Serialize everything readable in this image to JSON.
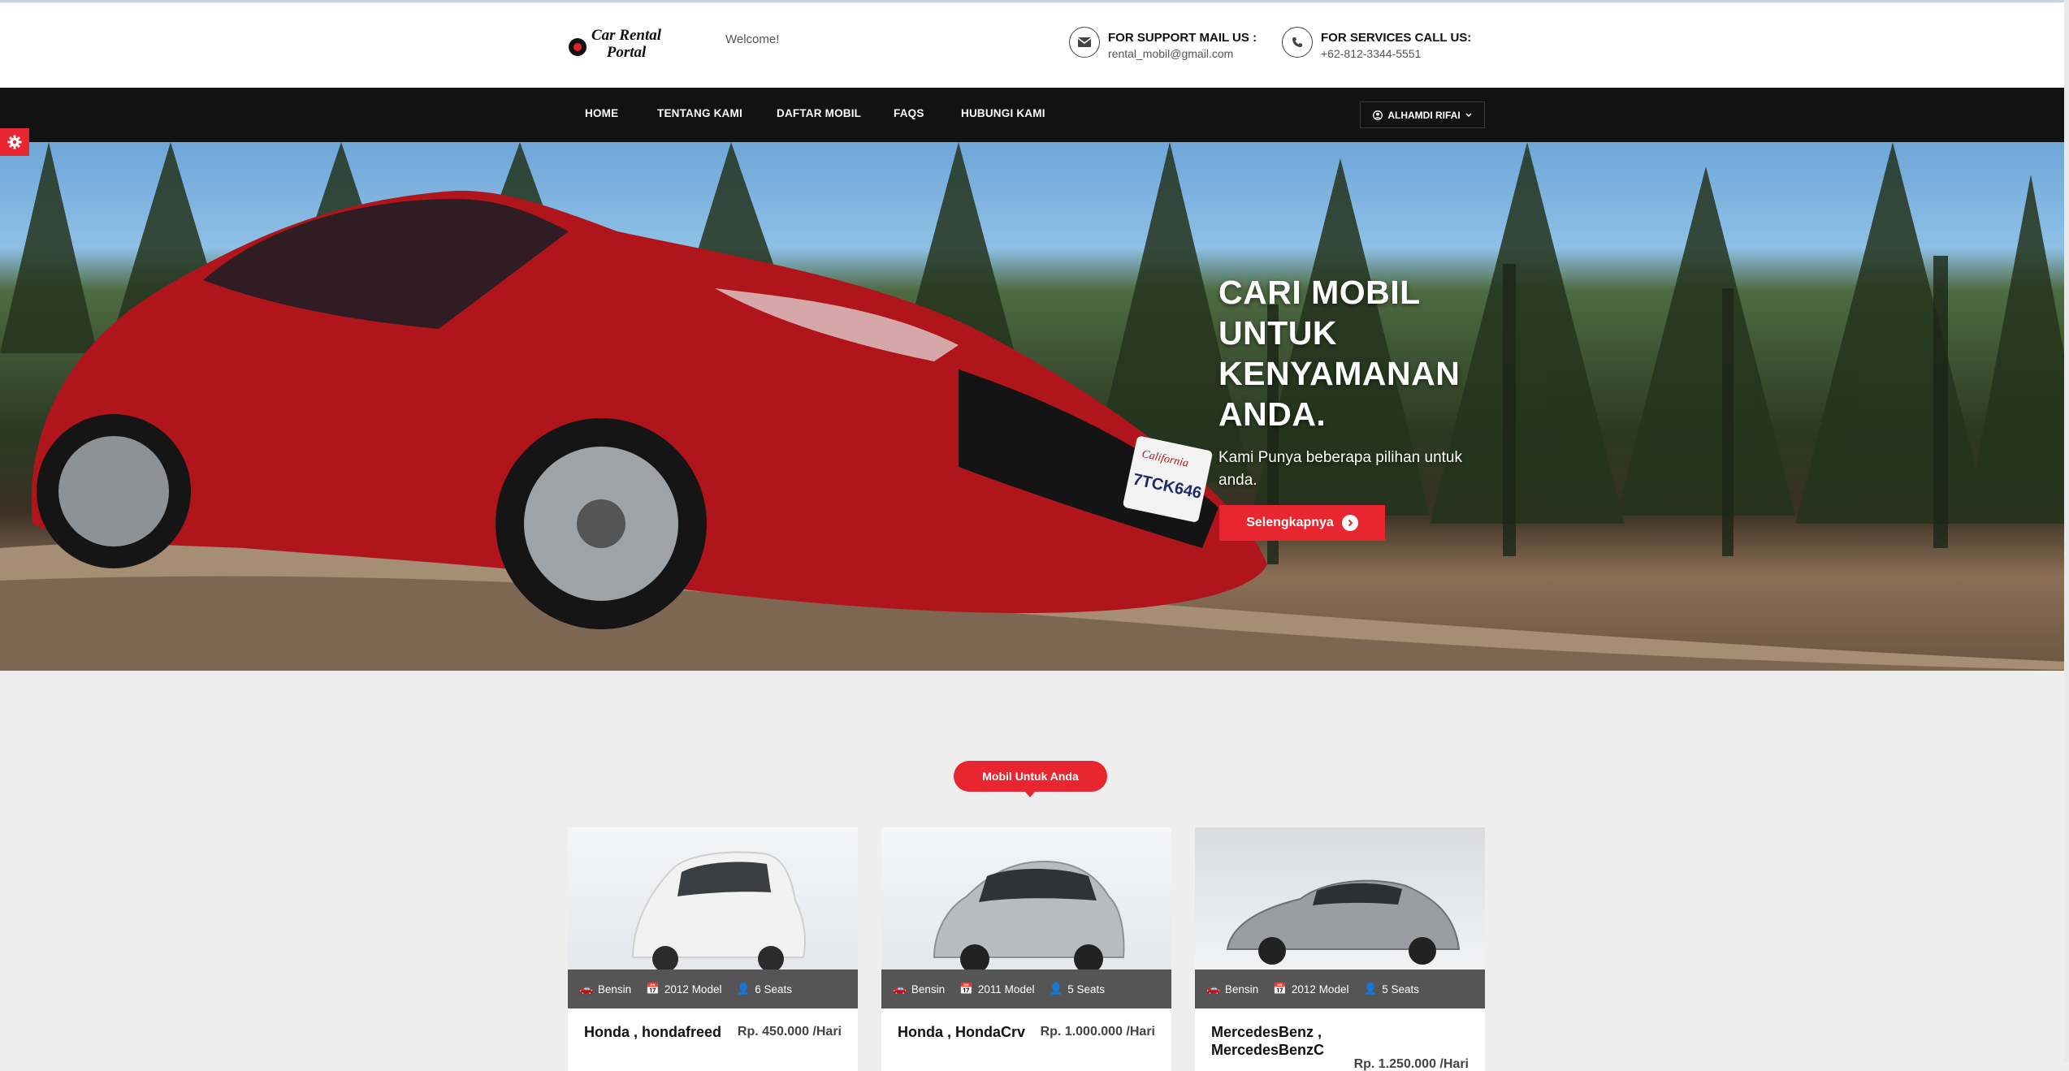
{
  "header": {
    "logo_line1": "Car Rental",
    "logo_line2": "Portal",
    "welcome": "Welcome!",
    "support": {
      "title": "FOR SUPPORT MAIL US :",
      "value": "rental_mobil@gmail.com"
    },
    "services": {
      "title": "FOR SERVICES CALL US:",
      "value": "+62-812-3344-5551"
    }
  },
  "nav": {
    "items": [
      "HOME",
      "TENTANG KAMI",
      "DAFTAR MOBIL",
      "FAQS",
      "HUBUNGI KAMI"
    ],
    "user": "ALHAMDI RIFAI"
  },
  "hero": {
    "title": "CARI MOBIL UNTUK KENYAMANAN ANDA.",
    "subtitle": "Kami Punya beberapa pilihan untuk anda.",
    "button": "Selengkapnya",
    "plate_top": "California",
    "plate_number": "7TCK646"
  },
  "section": {
    "badge": "Mobil Untuk Anda"
  },
  "cars": [
    {
      "fuel": "Bensin",
      "model": "2012 Model",
      "seats": "6 Seats",
      "name": "Honda , hondafreed",
      "price": "Rp. 450.000 /Hari",
      "color": "#f2f2f2"
    },
    {
      "fuel": "Bensin",
      "model": "2011 Model",
      "seats": "5 Seats",
      "name": "Honda , HondaCrv",
      "price": "Rp. 1.000.000 /Hari",
      "color": "#b9bcbf"
    },
    {
      "fuel": "Bensin",
      "model": "2012 Model",
      "seats": "5 Seats",
      "name": "MercedesBenz , MercedesBenzC",
      "price": "Rp. 1.250.000 /Hari",
      "color": "#9a9da1"
    }
  ],
  "colors": {
    "accent": "#e8262f",
    "nav_bg": "#121212",
    "card_bar": "#555555"
  }
}
